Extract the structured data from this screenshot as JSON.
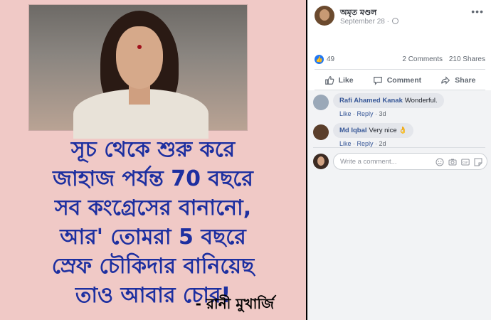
{
  "image_post": {
    "quote_lines": [
      "সূচ থেকে শুরু করে",
      "জাহাজ পর্যন্ত 70 বছরে",
      "সব কংগ্রেসের বানানো,",
      "আর' তোমরা 5 বছরে",
      "স্রেফ চৌকিদার বানিয়েছ",
      "তাও আবার চোর!"
    ],
    "attribution": "- রানী মুখার্জি"
  },
  "post": {
    "author": "অমৃত মণ্ডল",
    "date": "September 28 ·",
    "more_icon": "more-icon",
    "likes_count": "49",
    "comments_count": "2 Comments",
    "shares_count": "210 Shares"
  },
  "actions": {
    "like": "Like",
    "comment": "Comment",
    "share": "Share"
  },
  "comments": [
    {
      "author": "Rafi Ahamed Kanak",
      "text": "Wonderful.",
      "like": "Like",
      "reply": "Reply",
      "time": "3d"
    },
    {
      "author": "Md Iqbal",
      "text": "Very nice 👌",
      "like": "Like",
      "reply": "Reply",
      "time": "2d"
    }
  ],
  "write_comment": {
    "placeholder": "Write a comment..."
  },
  "colors": {
    "fb_blue": "#385898",
    "like_blue": "#2078f4",
    "quote_blue": "#1d2fa0",
    "post_pink": "#f0c9c6"
  }
}
